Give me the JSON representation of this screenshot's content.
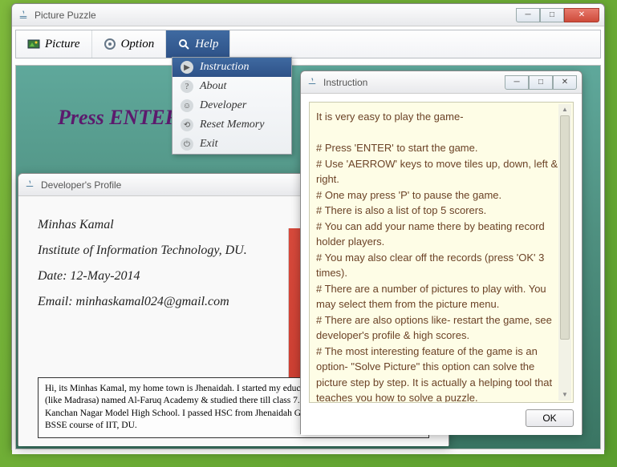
{
  "main": {
    "title": "Picture Puzzle",
    "menubar": {
      "picture": "Picture",
      "option": "Option",
      "help": "Help"
    },
    "press_enter": "Press ENTER to",
    "help_menu": {
      "instruction": "Instruction",
      "about": "About",
      "developer": "Developer",
      "reset_memory": "Reset Memory",
      "exit": "Exit"
    }
  },
  "profile": {
    "title": "Developer's Profile",
    "name": "Minhas Kamal",
    "institute": "Institute of Information Technology, DU.",
    "date": "Date: 12-May-2014",
    "email": "Email: minhaskamal024@gmail.com",
    "bio": "Hi, its Minhas Kamal, my home town is Jhenaidah. I started my education in a Arbi-Medium School (like Madrasa) named Al-Faruq Academy & studied there till class 7. I completed my SSC from Kanchan Nagar Model High School. I passed HSC from Jhenaidah Govt. K.C. College. Now I am in BSSE course of IIT, DU."
  },
  "instruction": {
    "title": "Instruction",
    "intro": "It is very easy to play the game-",
    "l1": "#  Press 'ENTER' to start the game.",
    "l2": "#  Use 'AERROW' keys to move tiles up, down, left & right.",
    "l3": "#  One may press 'P' to pause the game.",
    "l4": "#  There is also a list of top 5 scorers.",
    "l5": "#  You  can add  your name there by beating record holder players.",
    "l6": "#  You may also clear off the  records (press 'OK' 3 times).",
    "l7": "#  There are a number of pictures to play with. You may select them from the picture menu.",
    "l8": "#  There are also options like- restart the game, see developer's profile & high scores.",
    "l9": "#  The most interesting feature of the game is an option- \"Solve Picture\" this option can solve the picture step by step. It is actually a helping tool that teaches you how to solve a puzzle.",
    "ok": "OK"
  }
}
